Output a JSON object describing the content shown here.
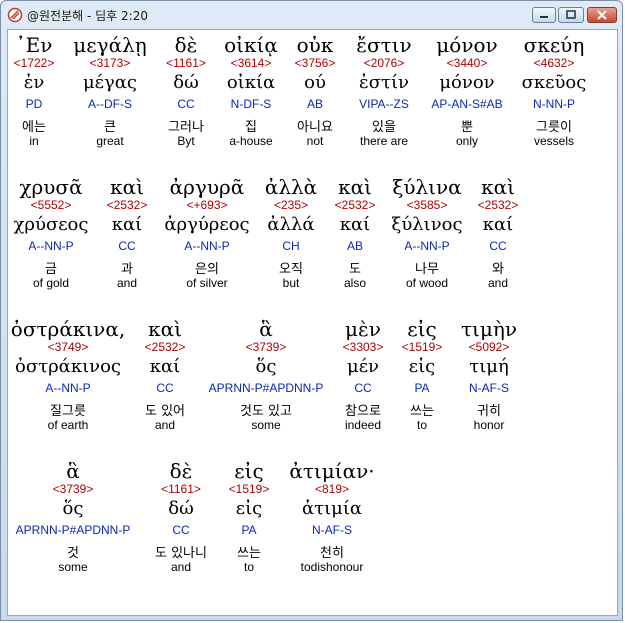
{
  "window": {
    "title": "@원전분해 - 딤후 2:20",
    "controls": {
      "minimize": "minimize",
      "maximize": "maximize",
      "close": "close"
    }
  },
  "colors": {
    "strong": "#b00000",
    "morph": "#0b28b5",
    "text": "#000000"
  },
  "rows": [
    {
      "words": [
        {
          "greek": "᾽Εν",
          "strong": "<1722>",
          "lemma": "ἐν",
          "morph": "PD",
          "korean": "에는",
          "english": "in"
        },
        {
          "greek": "μεγάλῃ",
          "strong": "<3173>",
          "lemma": "μέγας",
          "morph": "A--DF-S",
          "korean": "큰",
          "english": "great"
        },
        {
          "greek": "δὲ",
          "strong": "<1161>",
          "lemma": "δώ",
          "morph": "CC",
          "korean": "그러나",
          "english": "Byt"
        },
        {
          "greek": "οἰκίᾳ",
          "strong": "<3614>",
          "lemma": "οἰκία",
          "morph": "N-DF-S",
          "korean": "집",
          "english": "a-house"
        },
        {
          "greek": "οὐκ",
          "strong": "<3756>",
          "lemma": "ού",
          "morph": "AB",
          "korean": "아니요",
          "english": "not"
        },
        {
          "greek": "ἔστιν",
          "strong": "<2076>",
          "lemma": "ἐστίν",
          "morph": "VIPA--ZS",
          "korean": "있을",
          "english": "there are"
        },
        {
          "greek": "μόνον",
          "strong": "<3440>",
          "lemma": "μόνον",
          "morph": "AP-AN-S#AB",
          "korean": "뿐",
          "english": "only"
        },
        {
          "greek": "σκεύη",
          "strong": "<4632>",
          "lemma": "σκεῦος",
          "morph": "N-NN-P",
          "korean": "그릇이",
          "english": "vessels"
        }
      ]
    },
    {
      "words": [
        {
          "greek": "χρυσᾶ",
          "strong": "<5552>",
          "lemma": "χρύσεος",
          "morph": "A--NN-P",
          "korean": "금",
          "english": "of gold"
        },
        {
          "greek": "καὶ",
          "strong": "<2532>",
          "lemma": "καί",
          "morph": "CC",
          "korean": "과",
          "english": "and"
        },
        {
          "greek": "ἀργυρᾶ",
          "strong": "<+693>",
          "lemma": "ἀργύρεος",
          "morph": "A--NN-P",
          "korean": "은의",
          "english": "of silver"
        },
        {
          "greek": "ἀλλὰ",
          "strong": "<235>",
          "lemma": "ἀλλά",
          "morph": "CH",
          "korean": "오직",
          "english": "but"
        },
        {
          "greek": "καὶ",
          "strong": "<2532>",
          "lemma": "καί",
          "morph": "AB",
          "korean": "도",
          "english": "also"
        },
        {
          "greek": "ξύλινα",
          "strong": "<3585>",
          "lemma": "ξύλινος",
          "morph": "A--NN-P",
          "korean": "나무",
          "english": "of wood"
        },
        {
          "greek": "καὶ",
          "strong": "<2532>",
          "lemma": "καί",
          "morph": "CC",
          "korean": "와",
          "english": "and"
        }
      ]
    },
    {
      "words": [
        {
          "greek": "ὀστράκινα,",
          "strong": "<3749>",
          "lemma": "ὀστράκινος",
          "morph": "A--NN-P",
          "korean": "질그릇",
          "english": "of earth"
        },
        {
          "greek": "καὶ",
          "strong": "<2532>",
          "lemma": "καί",
          "morph": "CC",
          "korean": "도 있어",
          "english": "and"
        },
        {
          "greek": "ἃ",
          "strong": "<3739>",
          "lemma": "ὅς",
          "morph": "APRNN-P#APDNN-P",
          "korean": "것도 있고",
          "english": "some"
        },
        {
          "greek": "μὲν",
          "strong": "<3303>",
          "lemma": "μέν",
          "morph": "CC",
          "korean": "참으로",
          "english": "indeed"
        },
        {
          "greek": "εἰς",
          "strong": "<1519>",
          "lemma": "εἰς",
          "morph": "PA",
          "korean": "쓰는",
          "english": "to"
        },
        {
          "greek": "τιμὴν",
          "strong": "<5092>",
          "lemma": "τιμή",
          "morph": "N-AF-S",
          "korean": "귀히",
          "english": "honor"
        }
      ]
    },
    {
      "words": [
        {
          "greek": "ἃ",
          "strong": "<3739>",
          "lemma": "ὅς",
          "morph": "APRNN-P#APDNN-P",
          "korean": "것",
          "english": "some"
        },
        {
          "greek": "δὲ",
          "strong": "<1161>",
          "lemma": "δώ",
          "morph": "CC",
          "korean": "도 있나니",
          "english": "and"
        },
        {
          "greek": "εἰς",
          "strong": "<1519>",
          "lemma": "εἰς",
          "morph": "PA",
          "korean": "쓰는",
          "english": "to"
        },
        {
          "greek": "ἀτιμίαν·",
          "strong": "<819>",
          "lemma": "ἀτιμία",
          "morph": "N-AF-S",
          "korean": "천히",
          "english": "todishonour"
        }
      ]
    }
  ]
}
